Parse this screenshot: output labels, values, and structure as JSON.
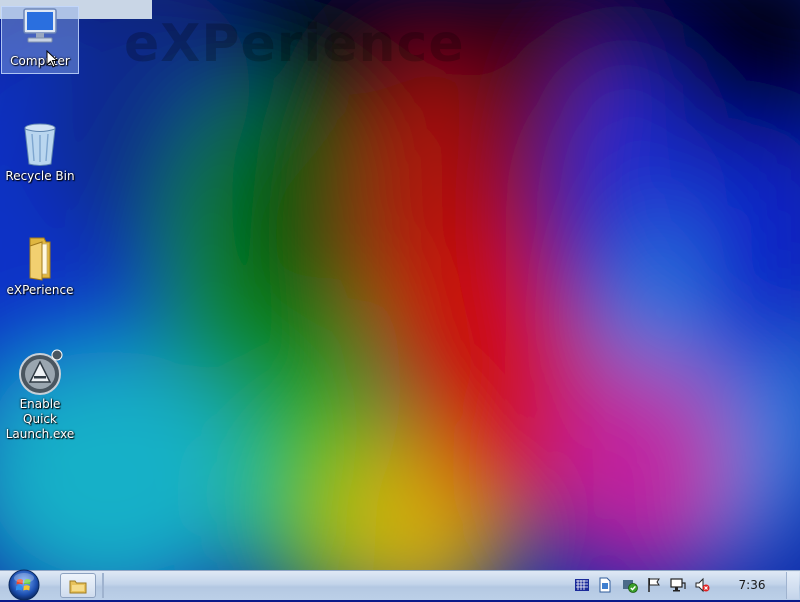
{
  "desktop": {
    "watermark": "eXPerience",
    "icons": [
      {
        "label": "Computer",
        "icon": "computer-icon",
        "selected": true
      },
      {
        "label": "Recycle Bin",
        "icon": "recycle-bin-icon"
      },
      {
        "label": "eXPerience",
        "icon": "folder-icon"
      },
      {
        "label": "Enable Quick Launch.exe",
        "icon": "aimp-app-icon"
      }
    ]
  },
  "taskbar": {
    "start_icon": "windows-orb-icon",
    "pinned": [
      {
        "icon": "explorer-folder-icon"
      }
    ],
    "tray": [
      {
        "icon": "language-flag-icon"
      },
      {
        "icon": "document-icon"
      },
      {
        "icon": "security-shield-icon"
      },
      {
        "icon": "action-center-flag-icon"
      },
      {
        "icon": "network-icon"
      },
      {
        "icon": "volume-muted-icon"
      }
    ],
    "clock": "7:36"
  }
}
